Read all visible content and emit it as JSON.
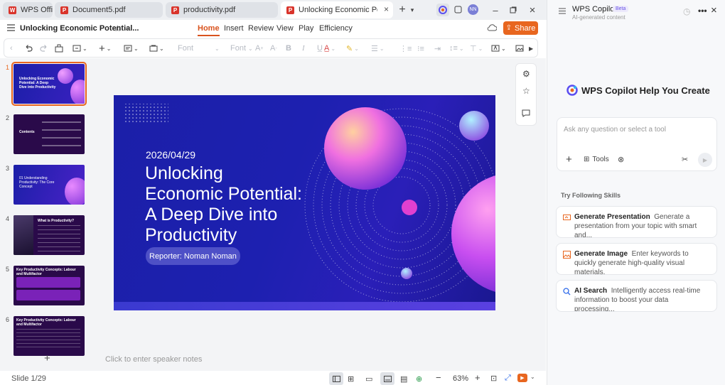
{
  "tabs": [
    {
      "label": "WPS Office",
      "icon": "wps-logo-icon",
      "active": false
    },
    {
      "label": "Document5.pdf",
      "icon": "pdf-icon",
      "active": false
    },
    {
      "label": "productivity.pdf",
      "icon": "pdf-icon",
      "active": false
    },
    {
      "label": "Unlocking Economic Potential A Deep Dive",
      "icon": "presentation-icon",
      "active": true
    }
  ],
  "user_avatar": "NN",
  "file_title": "Unlocking Economic Potential...",
  "menu": [
    "Home",
    "Insert",
    "Review",
    "View",
    "Play",
    "Efficiency"
  ],
  "active_menu": "Home",
  "share_label": "Share",
  "toolbar": {
    "font_name": "Font",
    "font_size": "Font"
  },
  "slides_count_visible": 6,
  "thumbs": [
    {
      "num": "1",
      "title": "Unlocking Economic Potential: A Deep Dive into Productivity"
    },
    {
      "num": "2",
      "title": "Contents"
    },
    {
      "num": "3",
      "title": "01 Understanding Productivity: The Core Concept"
    },
    {
      "num": "4",
      "title": "What is Productivity?"
    },
    {
      "num": "5",
      "title": "Key Productivity Concepts: Labour and Multifactor"
    },
    {
      "num": "6",
      "title": "Key Productivity Concepts: Labour and Multifactor"
    }
  ],
  "slide": {
    "date": "2026/04/29",
    "title_lines": [
      "Unlocking",
      "Economic Potential:",
      "A Deep Dive into",
      "Productivity"
    ],
    "reporter": "Reporter: Noman Noman"
  },
  "speaker_notes_placeholder": "Click to enter speaker notes",
  "status": {
    "slide_indicator": "Slide 1/29",
    "zoom": "63%"
  },
  "copilot": {
    "title": "WPS Copilot",
    "badge": "Beta",
    "subtitle": "AI-generated content",
    "heading": "WPS Copilot Help You Create",
    "input_placeholder": "Ask any question or select a tool",
    "tools_label": "Tools",
    "skills_heading": "Try Following Skills",
    "skills": [
      {
        "name": "Generate Presentation",
        "desc": "Generate a presentation from your topic with smart and...",
        "icon": "presentation-gen-icon",
        "color": "#e8661f"
      },
      {
        "name": "Generate Image",
        "desc": "Enter keywords to quickly generate high-quality visual materials.",
        "icon": "image-gen-icon",
        "color": "#e8661f"
      },
      {
        "name": "AI Search",
        "desc": "Intelligently access real-time information to boost your data processing...",
        "icon": "ai-search-icon",
        "color": "#2f6bea"
      }
    ]
  },
  "colors": {
    "accent": "#e8661f",
    "slide_bg": "#1d20b0",
    "selected_outline": "#e8661f"
  }
}
